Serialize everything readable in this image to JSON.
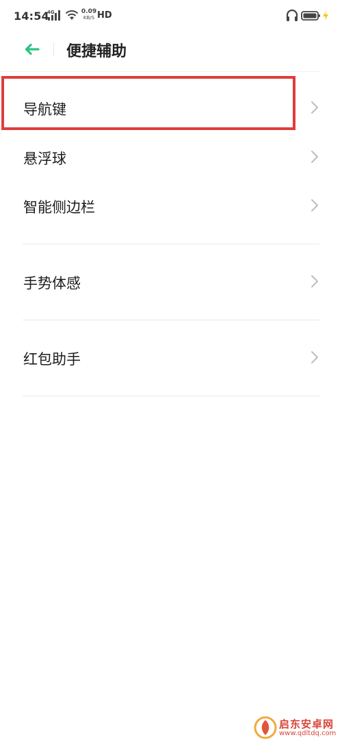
{
  "status_bar": {
    "time": "14:54",
    "network": "4G",
    "speed_value": "0.09",
    "speed_unit": "KB/S",
    "hd": "HD"
  },
  "header": {
    "title": "便捷辅助"
  },
  "list": {
    "items": [
      {
        "label": "导航键"
      },
      {
        "label": "悬浮球"
      },
      {
        "label": "智能侧边栏"
      },
      {
        "label": "手势体感"
      },
      {
        "label": "红包助手"
      }
    ]
  },
  "watermark": {
    "brand": "启东安卓网",
    "url": "www.qdltdq.com"
  },
  "colors": {
    "accent": "#2bc381",
    "highlight": "#e03c3c",
    "watermark": "#d8453a"
  }
}
